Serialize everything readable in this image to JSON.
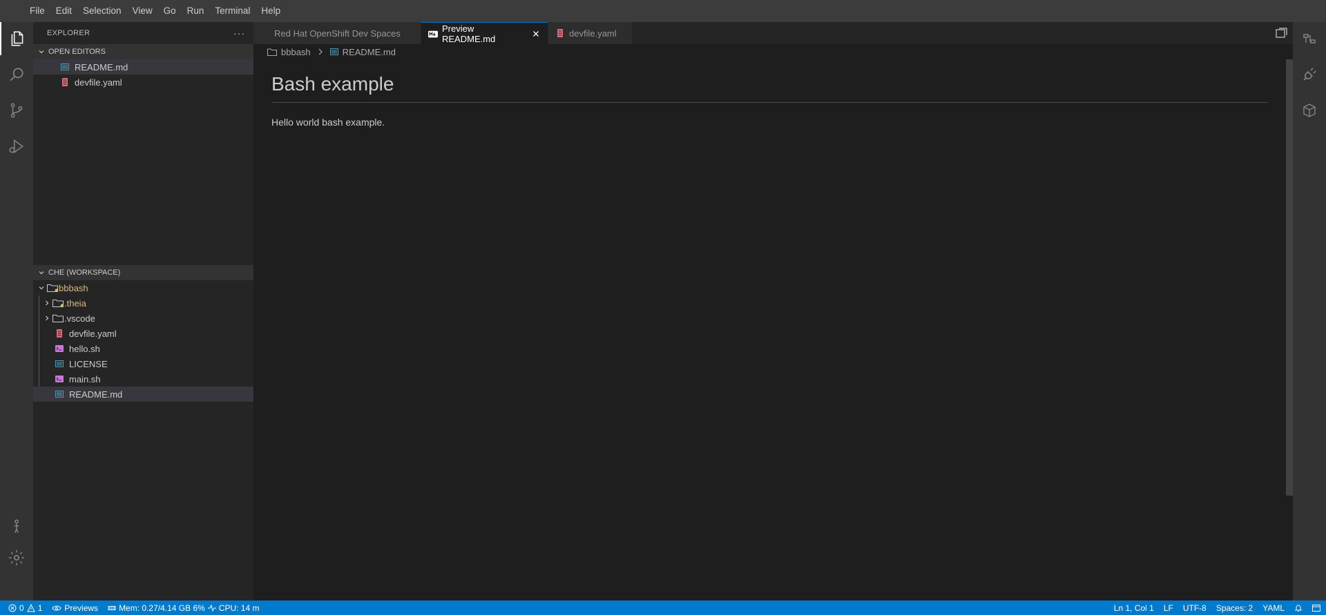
{
  "menu": [
    "File",
    "Edit",
    "Selection",
    "View",
    "Go",
    "Run",
    "Terminal",
    "Help"
  ],
  "sidebar": {
    "title": "EXPLORER",
    "more": "···",
    "open_editors": {
      "title": "OPEN EDITORS",
      "items": [
        {
          "label": "README.md",
          "icon": "markdown-file-icon",
          "selected": true
        },
        {
          "label": "devfile.yaml",
          "icon": "yaml-file-icon",
          "selected": false
        }
      ]
    },
    "workspace": {
      "title": "CHE (WORKSPACE)",
      "root": "bbbash",
      "items": [
        {
          "label": ".theia",
          "type": "folder",
          "modified": true
        },
        {
          "label": ".vscode",
          "type": "folder",
          "modified": false
        },
        {
          "label": "devfile.yaml",
          "type": "yaml"
        },
        {
          "label": "hello.sh",
          "type": "shell"
        },
        {
          "label": "LICENSE",
          "type": "text"
        },
        {
          "label": "main.sh",
          "type": "shell"
        },
        {
          "label": "README.md",
          "type": "markdown",
          "selected": true
        }
      ]
    }
  },
  "tabs": [
    {
      "label": "Red Hat OpenShift Dev Spaces",
      "active": false
    },
    {
      "label": "Preview README.md",
      "active": true
    },
    {
      "label": "devfile.yaml",
      "active": false
    }
  ],
  "breadcrumb": {
    "folder": "bbbash",
    "file": "README.md"
  },
  "preview": {
    "heading": "Bash example",
    "body": "Hello world bash example."
  },
  "status": {
    "errors": "0",
    "warnings": "1",
    "previews": "Previews",
    "mem": "Mem: 0.27/4.14 GB 6%",
    "cpu": "CPU: 14 m",
    "position": "Ln 1, Col 1",
    "eol": "LF",
    "encoding": "UTF-8",
    "spaces": "Spaces: 2",
    "language": "YAML"
  },
  "colors": {
    "accent": "#007acc",
    "modified": "#d7ba7d",
    "yaml_icon": "#e06c75",
    "markdown_icon": "#519aba",
    "shell_icon": "#c678dd"
  }
}
